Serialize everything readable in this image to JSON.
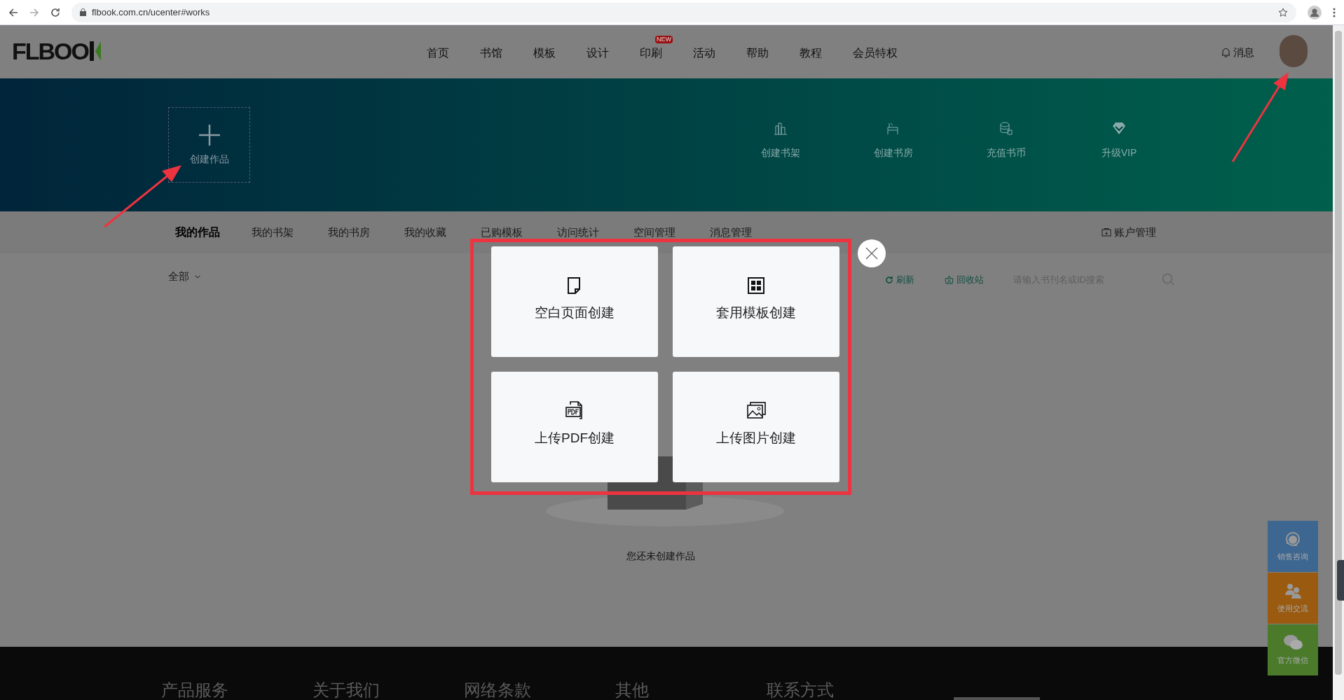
{
  "browser": {
    "url": "flbook.com.cn/ucenter#works"
  },
  "header": {
    "logo": "FLBOO",
    "nav": [
      {
        "label": "首页"
      },
      {
        "label": "书馆"
      },
      {
        "label": "模板"
      },
      {
        "label": "设计"
      },
      {
        "label": "印刷",
        "badge": "NEW"
      },
      {
        "label": "活动"
      },
      {
        "label": "帮助"
      },
      {
        "label": "教程"
      },
      {
        "label": "会员特权"
      }
    ],
    "messages": "消息"
  },
  "banner": {
    "create": "创建作品",
    "actions": [
      {
        "kind": "shelf",
        "label": "创建书架"
      },
      {
        "kind": "study",
        "label": "创建书房"
      },
      {
        "kind": "coins",
        "label": "充值书币"
      },
      {
        "kind": "diamond",
        "label": "升级VIP"
      }
    ]
  },
  "tabs": [
    {
      "label": "我的作品",
      "selected": true
    },
    {
      "label": "我的书架",
      "selected": false
    },
    {
      "label": "我的书房",
      "selected": false
    },
    {
      "label": "我的收藏",
      "selected": false
    },
    {
      "label": "已购模板",
      "selected": false
    },
    {
      "label": "访问统计",
      "selected": false
    },
    {
      "label": "空间管理",
      "selected": false
    },
    {
      "label": "消息管理",
      "selected": false
    }
  ],
  "account": "账户管理",
  "toolbar": {
    "filter": "全部",
    "refresh": "刷新",
    "recycle": "回收站",
    "search": {
      "placeholder": "请输入书刊名或ID搜索"
    }
  },
  "empty_message": "您还未创建作品",
  "modal": {
    "options": [
      {
        "kind": "blank",
        "label": "空白页面创建"
      },
      {
        "kind": "template",
        "label": "套用模板创建"
      },
      {
        "kind": "pdf",
        "label": "上传PDF创建"
      },
      {
        "kind": "image",
        "label": "上传图片创建"
      }
    ]
  },
  "side_widgets": [
    {
      "kind": "headset",
      "label": "销售咨询",
      "color": "#3d6690"
    },
    {
      "kind": "people",
      "label": "使用交流",
      "color": "#9a5a10"
    },
    {
      "kind": "chat",
      "label": "官方微信",
      "color": "#4a7a2a"
    }
  ],
  "footer": {
    "headings": [
      "产品服务",
      "关于我们",
      "网络条款",
      "其他",
      "联系方式"
    ]
  }
}
